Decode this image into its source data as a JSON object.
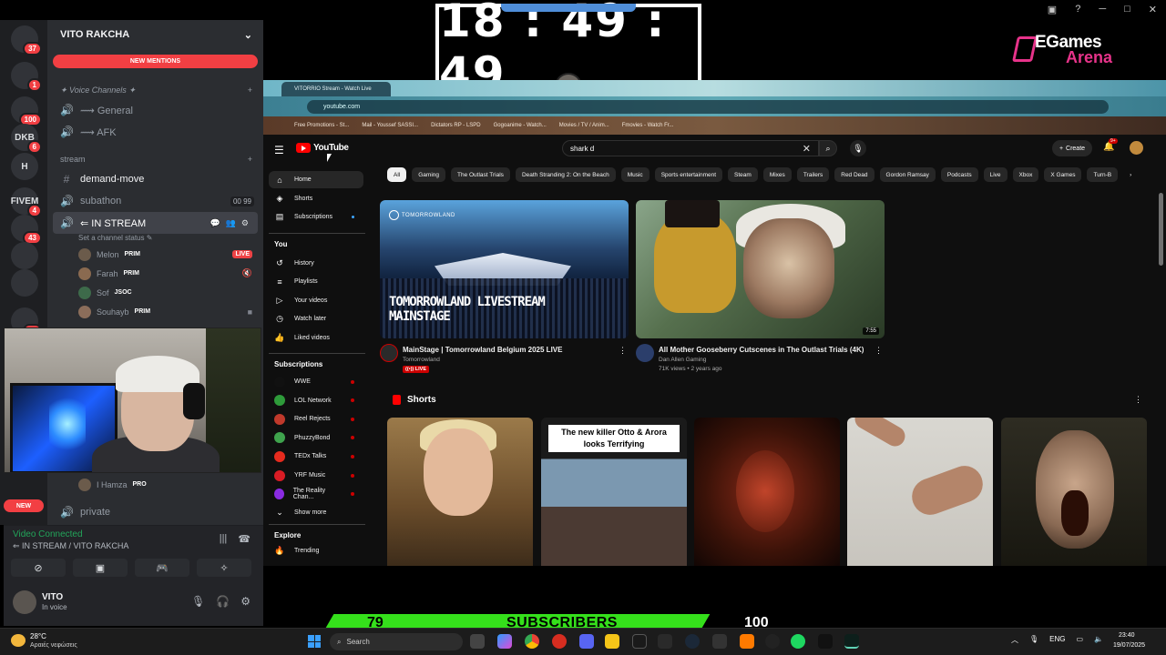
{
  "discord": {
    "servers": [
      {
        "icon": "discord-icon",
        "badge": "37"
      },
      {
        "icon": "server-avatar",
        "badge": "1"
      },
      {
        "icon": "server-avatar",
        "badge": "100"
      },
      {
        "icon": "server-dkb",
        "label": "DKB",
        "badge": "6"
      },
      {
        "icon": "server-h",
        "label": "H"
      },
      {
        "icon": "server-fivem",
        "label": "FIVEM",
        "badge": "4"
      },
      {
        "icon": "server-crown",
        "badge": "43"
      },
      {
        "icon": "server-avatar"
      },
      {
        "icon": "server-avatar"
      },
      {
        "icon": "server-avatar",
        "badge": "17"
      }
    ],
    "server_name": "VITO RAKCHA",
    "new_mentions": "NEW MENTIONS",
    "voice_category": "✦ Voice Channels ✦",
    "channels_top": [
      {
        "icon": "speaker-icon",
        "name": "⟿ General"
      },
      {
        "icon": "speaker-icon",
        "name": "⟿ AFK"
      }
    ],
    "stream_category": "stream",
    "channels_stream": [
      {
        "icon": "text-channel-icon",
        "name": "demand-move",
        "bright": true
      },
      {
        "icon": "speaker-icon",
        "name": "subathon",
        "limit": "00 99"
      }
    ],
    "active_channel": {
      "name": "⇐ IN STREAM",
      "status": "Set a channel status ✎"
    },
    "voice_users": [
      {
        "name": "Melon",
        "role": "PRIM",
        "tag": "LIVE"
      },
      {
        "name": "Farah",
        "role": "PRIM",
        "trailing": "muted"
      },
      {
        "name": "Sof",
        "role": "JSOC"
      },
      {
        "name": "Souhayb",
        "role": "PRIM",
        "trailing": "camera"
      }
    ],
    "after_cam_user": {
      "name": "I Hamza",
      "role": "PRO"
    },
    "new_badge": "NEW",
    "private_channel": "private",
    "voice_connected": "Video Connected",
    "voice_location": "⇐ IN STREAM / VITO RAKCHA",
    "user_name": "VITO",
    "user_state": "In voice"
  },
  "overlay": {
    "clock": "18 : 49 : 49",
    "brand_line1": "EGames",
    "brand_line2": "Arena"
  },
  "browser": {
    "tab_title": "VITORRIO Stream - Watch Live",
    "url": "youtube.com",
    "bookmarks": [
      "Free Promotions - St...",
      "Mail - Youssef SASSI...",
      "Dictators RP - LSPD",
      "Gogoanime - Watch...",
      "Movies / TV / Anim...",
      "Fmovies - Watch Fr..."
    ]
  },
  "youtube": {
    "logo": "YouTube",
    "search_value": "shark d",
    "create_label": "Create",
    "bell_count": "9+",
    "sidebar_main": [
      {
        "icon": "home-icon",
        "label": "Home",
        "active": true
      },
      {
        "icon": "shorts-icon",
        "label": "Shorts"
      },
      {
        "icon": "subscriptions-icon",
        "label": "Subscriptions",
        "dot": true
      }
    ],
    "you_heading": "You",
    "sidebar_you": [
      {
        "icon": "history-icon",
        "label": "History"
      },
      {
        "icon": "playlists-icon",
        "label": "Playlists"
      },
      {
        "icon": "your-videos-icon",
        "label": "Your videos"
      },
      {
        "icon": "watch-later-icon",
        "label": "Watch later"
      },
      {
        "icon": "liked-videos-icon",
        "label": "Liked videos"
      }
    ],
    "subs_heading": "Subscriptions",
    "subscriptions": [
      {
        "label": "WWE",
        "color": "#111111"
      },
      {
        "label": "LOL Network",
        "color": "#2e9b3a"
      },
      {
        "label": "Reel Rejects",
        "color": "#c0392b"
      },
      {
        "label": "PhuzzyBond",
        "color": "#3fa34d"
      },
      {
        "label": "TEDx Talks",
        "color": "#e62b1e"
      },
      {
        "label": "YRF Music",
        "color": "#d91c24"
      },
      {
        "label": "The Reality Chan...",
        "color": "#8a2be2"
      }
    ],
    "show_more": "Show more",
    "explore_heading": "Explore",
    "trending": "Trending",
    "chips": [
      "All",
      "Gaming",
      "The Outlast Trials",
      "Death Stranding 2: On the Beach",
      "Music",
      "Sports entertainment",
      "Steam",
      "Mixes",
      "Trailers",
      "Red Dead",
      "Gordon Ramsay",
      "Podcasts",
      "Live",
      "Xbox",
      "X Games",
      "Turn-B"
    ],
    "videos": [
      {
        "thumb_brand": "TOMORROWLAND",
        "thumb_title_1": "TOMORROWLAND LIVESTREAM",
        "thumb_title_2": "MAINSTAGE",
        "title": "MainStage | Tomorrowland Belgium 2025 LIVE",
        "channel": "Tomorrowland",
        "live_label": "((•)) LIVE"
      },
      {
        "duration": "7:55",
        "title": "All Mother Gooseberry Cutscenes in The Outlast Trials (4K)",
        "channel": "Dan Allen Gaming",
        "meta": "71K views • 2 years ago"
      }
    ],
    "shorts_heading": "Shorts",
    "short2_caption": "The new killer Otto & Arora looks Terrifying"
  },
  "subscriber_goal": {
    "current": "79",
    "label": "SUBSCRIBERS",
    "goal": "100",
    "progress": 0.79
  },
  "taskbar": {
    "temp": "28°C",
    "weather": "Αραιές νεφώσεις",
    "search": "Search",
    "lang": "ENG",
    "time": "23:40",
    "date": "19/07/2025"
  },
  "colors": {
    "discord_red": "#f23f43",
    "youtube_red": "#ff0000",
    "sub_bar_green": "#35e01b",
    "brand_pink": "#e7338a"
  }
}
